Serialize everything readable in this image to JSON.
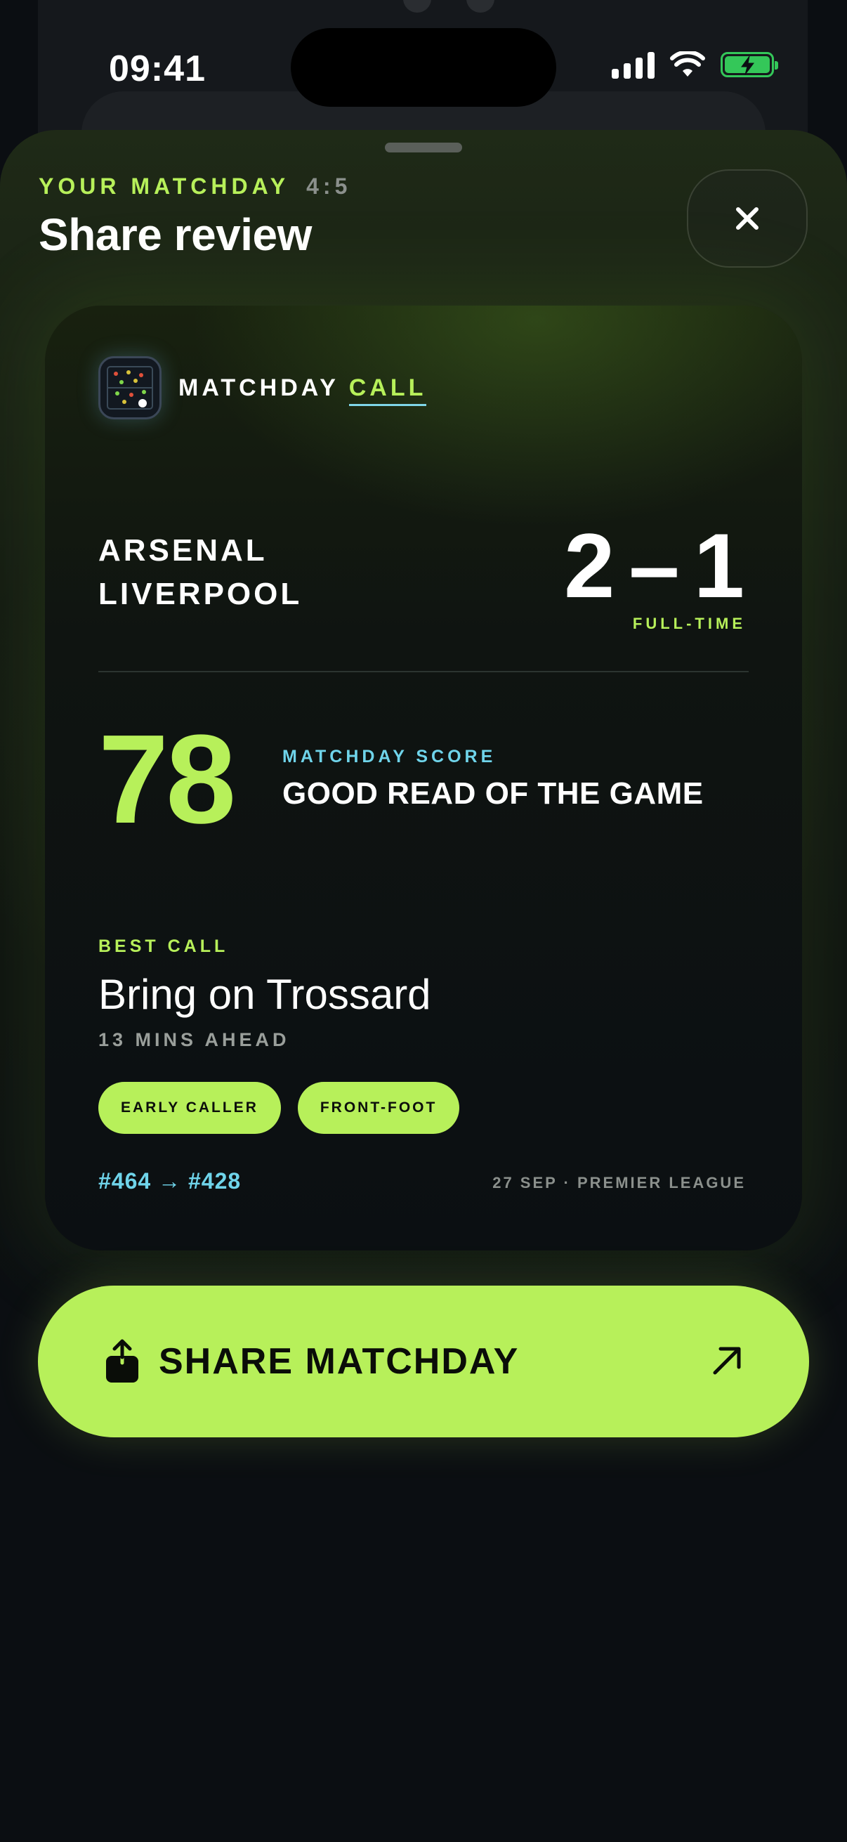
{
  "status_bar": {
    "time": "09:41"
  },
  "sheet": {
    "eyebrow": "YOUR MATCHDAY",
    "ratio": "4:5",
    "title": "Share review",
    "close_icon": "close-icon"
  },
  "card": {
    "brand_prefix": "MATCHDAY",
    "brand_suffix": "CALL",
    "teams": [
      "ARSENAL",
      "LIVERPOOL"
    ],
    "score_home": "2",
    "score_sep": "–",
    "score_away": "1",
    "status": "FULL-TIME",
    "matchday_score": "78",
    "score_label": "MATCHDAY SCORE",
    "score_verdict": "GOOD READ OF THE GAME",
    "best_label": "BEST CALL",
    "best_call": "Bring on Trossard",
    "best_sub": "13 MINS AHEAD",
    "tags": [
      "EARLY CALLER",
      "FRONT-FOOT"
    ],
    "rank": "#464 → #428",
    "meta": "27 SEP · PREMIER LEAGUE"
  },
  "share_button": {
    "label": "SHARE MATCHDAY",
    "icon": "share-icon",
    "arrow": "arrow-up-right-icon"
  },
  "colors": {
    "accent": "#b7f05a",
    "cyan": "#6fd4ea",
    "background": "#0b0e12"
  }
}
